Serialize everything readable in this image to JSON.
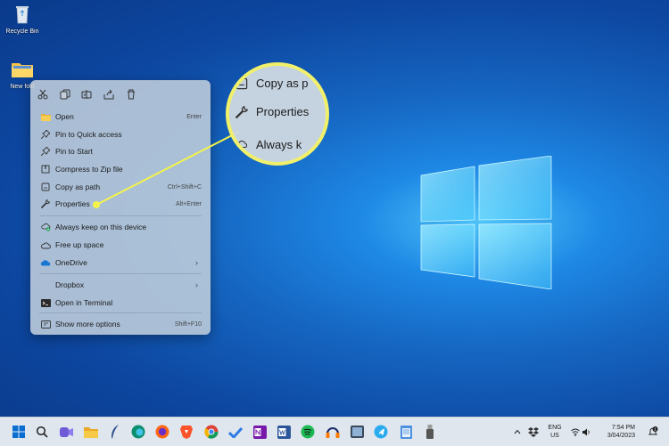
{
  "desktop": {
    "icons": [
      {
        "label": "Recycle Bin",
        "icon": "recycle-bin-icon"
      },
      {
        "label": "New fold",
        "icon": "folder-icon"
      }
    ]
  },
  "context_menu": {
    "quick_actions": [
      {
        "icon": "cut-icon"
      },
      {
        "icon": "copy-icon"
      },
      {
        "icon": "rename-icon"
      },
      {
        "icon": "share-icon"
      },
      {
        "icon": "delete-icon"
      }
    ],
    "items": [
      {
        "label": "Open",
        "shortcut": "Enter",
        "icon": "folder-open-icon"
      },
      {
        "label": "Pin to Quick access",
        "shortcut": "",
        "icon": "pin-icon"
      },
      {
        "label": "Pin to Start",
        "shortcut": "",
        "icon": "pin-icon"
      },
      {
        "label": "Compress to Zip file",
        "shortcut": "",
        "icon": "zip-icon"
      },
      {
        "label": "Copy as path",
        "shortcut": "Ctrl+Shift+C",
        "icon": "copy-path-icon"
      },
      {
        "label": "Properties",
        "shortcut": "Alt+Enter",
        "icon": "wrench-icon"
      },
      {
        "label": "Always keep on this device",
        "shortcut": "",
        "icon": "cloud-check-icon"
      },
      {
        "label": "Free up space",
        "shortcut": "",
        "icon": "cloud-icon"
      },
      {
        "label": "OneDrive",
        "shortcut": "",
        "icon": "onedrive-icon",
        "submenu": true
      },
      {
        "label": "Dropbox",
        "shortcut": "",
        "icon": "",
        "submenu": true
      },
      {
        "label": "Open in Terminal",
        "shortcut": "",
        "icon": "terminal-icon"
      },
      {
        "label": "Show more options",
        "shortcut": "Shift+F10",
        "icon": "more-options-icon"
      }
    ],
    "chevron": "›"
  },
  "magnifier": {
    "rows": [
      "Copy as p",
      "Properties",
      "Always k"
    ]
  },
  "taskbar": {
    "apps": [
      "start-icon",
      "search-icon",
      "meet-icon",
      "file-explorer-icon",
      "feather-icon",
      "edge-icon",
      "firefox-icon",
      "brave-icon",
      "chrome-icon",
      "todo-icon",
      "onenote-icon",
      "word-icon",
      "spotify-icon",
      "audacity-icon",
      "photos-icon",
      "telegram-icon",
      "notepad-icon",
      "usb-icon"
    ],
    "tray": {
      "lang_top": "ENG",
      "lang_bottom": "US",
      "time": "7:54 PM",
      "date": "3/04/2023",
      "notification_count": "1"
    }
  },
  "colors": {
    "accent_yellow": "#f3f34a",
    "menu_bg": "#c4d0dc",
    "taskbar_bg": "#dfe6ee"
  }
}
